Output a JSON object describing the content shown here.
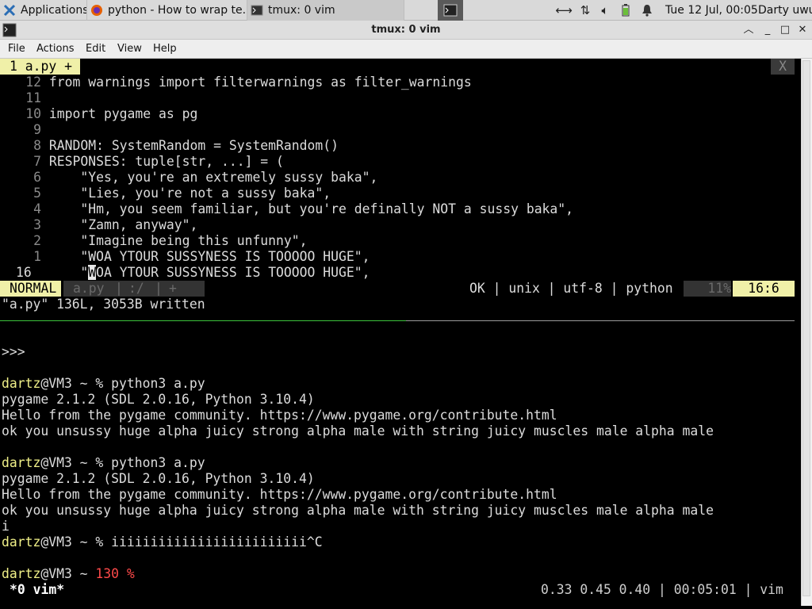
{
  "taskbar": {
    "tasks": [
      {
        "label": "Applications ☰",
        "icon": "xfce-mouse-icon"
      },
      {
        "label": "python - How to wrap te...",
        "icon": "firefox-icon"
      },
      {
        "label": "tmux: 0 vim",
        "icon": "terminal-icon"
      }
    ],
    "tray": [
      "network-icon",
      "transfer-icon",
      "volume-icon",
      "battery-icon",
      "notification-bell-icon"
    ],
    "clock": "Tue 12 Jul, 00:05",
    "user": "Darty uwu"
  },
  "window": {
    "title": "tmux: 0 vim",
    "menu": [
      "File",
      "Actions",
      "Edit",
      "View",
      "Help"
    ]
  },
  "vim": {
    "tab_label": "1 a.py +",
    "tab_close": "X",
    "lines": [
      {
        "num": "12",
        "text": "from warnings import filterwarnings as filter_warnings"
      },
      {
        "num": "11",
        "text": ""
      },
      {
        "num": "10",
        "text": "import pygame as pg"
      },
      {
        "num": "9",
        "text": ""
      },
      {
        "num": "8",
        "text": "RANDOM: SystemRandom = SystemRandom()"
      },
      {
        "num": "7",
        "text": "RESPONSES: tuple[str, ...] = ("
      },
      {
        "num": "6",
        "text": "    \"Yes, you're an extremely sussy baka\","
      },
      {
        "num": "5",
        "text": "    \"Lies, you're not a sussy baka\","
      },
      {
        "num": "4",
        "text": "    \"Hm, you seem familiar, but you're definally NOT a sussy baka\","
      },
      {
        "num": "3",
        "text": "    \"Zamn, anyway\","
      },
      {
        "num": "2",
        "text": "    \"Imagine being this unfunny\","
      },
      {
        "num": "1",
        "text": "    \"WOA YTOUR SUSSYNESS IS TOOOOO HUGE\","
      }
    ],
    "current": {
      "num": "16",
      "before": "    \"",
      "cursor_char": "W",
      "after": "OA YTOUR SUSSYNESS IS TOOOOO HUGE\","
    },
    "status": {
      "mode": "NORMAL",
      "file": "a.py",
      "sep1": "|",
      "path": ":/",
      "sep2": "|",
      "plus": "+",
      "info": "OK | unix | utf-8 | python",
      "percent": "11%",
      "position": "16:6"
    },
    "message": "\"a.py\" 136L, 3053B written"
  },
  "shell": {
    "lines": [
      {
        "type": "plain",
        "text": ""
      },
      {
        "type": "repl",
        "text": ">>>"
      },
      {
        "type": "plain",
        "text": ""
      },
      {
        "type": "prompt",
        "user": "dartz",
        "host": "@VM3 ~ % ",
        "cmd": "python3 a.py"
      },
      {
        "type": "plain",
        "text": "pygame 2.1.2 (SDL 2.0.16, Python 3.10.4)"
      },
      {
        "type": "plain",
        "text": "Hello from the pygame community. https://www.pygame.org/contribute.html"
      },
      {
        "type": "plain",
        "text": "ok you unsussy huge alpha juicy strong alpha male with string juicy muscles male alpha male"
      },
      {
        "type": "plain",
        "text": ""
      },
      {
        "type": "prompt",
        "user": "dartz",
        "host": "@VM3 ~ % ",
        "cmd": "python3 a.py"
      },
      {
        "type": "plain",
        "text": "pygame 2.1.2 (SDL 2.0.16, Python 3.10.4)"
      },
      {
        "type": "plain",
        "text": "Hello from the pygame community. https://www.pygame.org/contribute.html"
      },
      {
        "type": "plain",
        "text": "ok you unsussy huge alpha juicy strong alpha male with string juicy muscles male alpha male"
      },
      {
        "type": "plain",
        "text": "i"
      },
      {
        "type": "prompt",
        "user": "dartz",
        "host": "@VM3 ~ % ",
        "cmd": "iiiiiiiiiiiiiiiiiiiiiiiii^C"
      },
      {
        "type": "plain",
        "text": ""
      },
      {
        "type": "prompt-err",
        "user": "dartz",
        "host": "@VM3 ~ ",
        "code": "130 %",
        "cmd": ""
      }
    ]
  },
  "tmux": {
    "window": "*0 vim*",
    "right": "0.33 0.45 0.40 | 00:05:01 | vim"
  },
  "colors": {
    "tab_bg": "#f0f0a8",
    "user": "#f0f088",
    "error": "#ff4a4a",
    "separator_active": "#3cc43c"
  }
}
